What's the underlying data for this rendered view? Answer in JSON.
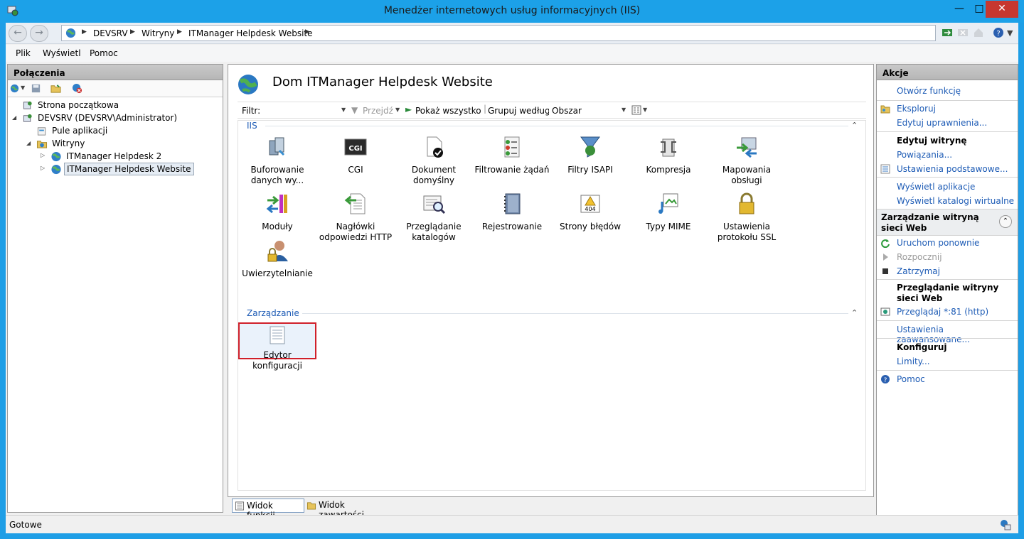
{
  "window": {
    "title": "Menedżer internetowych usług informacyjnych (IIS)"
  },
  "address": {
    "crumbs": [
      "DEVSRV",
      "Witryny",
      "ITManager Helpdesk Website"
    ]
  },
  "menu": {
    "items": [
      "Plik",
      "Wyświetl",
      "Pomoc"
    ]
  },
  "connections": {
    "title": "Połączenia",
    "tree": [
      {
        "label": "Strona początkowa"
      },
      {
        "label": "DEVSRV (DEVSRV\\Administrator)"
      },
      {
        "label": "Pule aplikacji"
      },
      {
        "label": "Witryny"
      },
      {
        "label": "ITManager Helpdesk 2"
      },
      {
        "label": "ITManager Helpdesk Website"
      }
    ]
  },
  "center": {
    "title": "Dom ITManager Helpdesk Website",
    "filter_label": "Filtr:",
    "go_label": "Przejdź",
    "show_all_label": "Pokaż wszystko",
    "group_by_label": "Grupuj według:",
    "group_by_value": "Obszar",
    "group_iis": "IIS",
    "group_mgmt": "Zarządzanie",
    "features_iis": [
      {
        "label": "Buforowanie danych wy..."
      },
      {
        "label": "CGI"
      },
      {
        "label": "Dokument domyślny"
      },
      {
        "label": "Filtrowanie żądań"
      },
      {
        "label": "Filtry ISAPI"
      },
      {
        "label": "Kompresja"
      },
      {
        "label": "Mapowania obsługi"
      },
      {
        "label": "Moduły"
      },
      {
        "label": "Nagłówki odpowiedzi HTTP"
      },
      {
        "label": "Przeglądanie katalogów"
      },
      {
        "label": "Rejestrowanie"
      },
      {
        "label": "Strony błędów"
      },
      {
        "label": "Typy MIME"
      },
      {
        "label": "Ustawienia protokołu SSL"
      },
      {
        "label": "Uwierzytelnianie"
      }
    ],
    "features_mgmt": [
      {
        "label": "Edytor konfiguracji"
      }
    ],
    "cgi_text": "CGI",
    "err_text": "404"
  },
  "views": {
    "features": "Widok funkcji",
    "content": "Widok zawartości"
  },
  "actions": {
    "title": "Akcje",
    "open_feature": "Otwórz funkcję",
    "explore": "Eksploruj",
    "edit_perms": "Edytuj uprawnienia...",
    "edit_site_head": "Edytuj witrynę",
    "bindings": "Powiązania...",
    "basic_settings": "Ustawienia podstawowe...",
    "view_apps": "Wyświetl aplikacje",
    "view_vdirs": "Wyświetl katalogi wirtualne",
    "manage_head": "Zarządzanie witryną sieci Web",
    "restart": "Uruchom ponownie",
    "start": "Rozpocznij",
    "stop": "Zatrzymaj",
    "browse_head": "Przeglądanie witryny sieci Web",
    "browse": "Przeglądaj *:81 (http)",
    "advanced": "Ustawienia zaawansowane...",
    "configure_head": "Konfiguruj",
    "limits": "Limity...",
    "help": "Pomoc"
  },
  "status": {
    "text": "Gotowe"
  }
}
